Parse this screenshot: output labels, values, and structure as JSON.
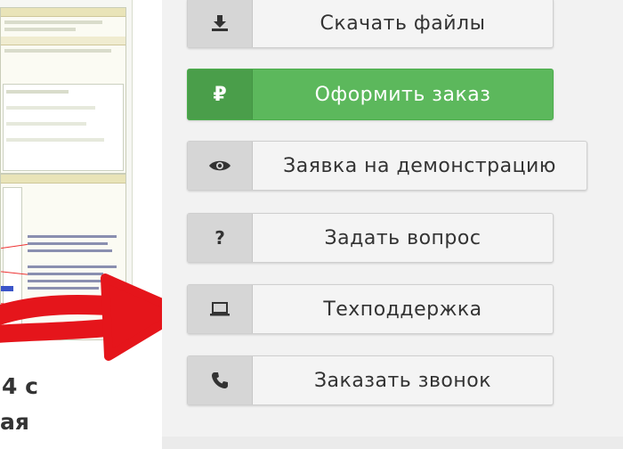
{
  "preview": {
    "caption_line1": "4 с",
    "caption_line2": "ая"
  },
  "buttons": [
    {
      "id": "download",
      "label": "Скачать файлы",
      "icon": "download-icon"
    },
    {
      "id": "order",
      "label": "Оформить заказ",
      "icon": "ruble-icon",
      "icon_text": "₽",
      "color": "#5cb85c"
    },
    {
      "id": "demo",
      "label": "Заявка на демонстрацию",
      "icon": "eye-icon"
    },
    {
      "id": "question",
      "label": "Задать вопрос",
      "icon": "question-icon",
      "icon_text": "?"
    },
    {
      "id": "support",
      "label": "Техподдержка",
      "icon": "laptop-icon"
    },
    {
      "id": "callback",
      "label": "Заказать звонок",
      "icon": "phone-icon"
    }
  ],
  "colors": {
    "panel_bg": "#f2f2f2",
    "button_bg": "#f4f4f4",
    "accent_green": "#5cb85c",
    "arrow_red": "#e5151b"
  }
}
